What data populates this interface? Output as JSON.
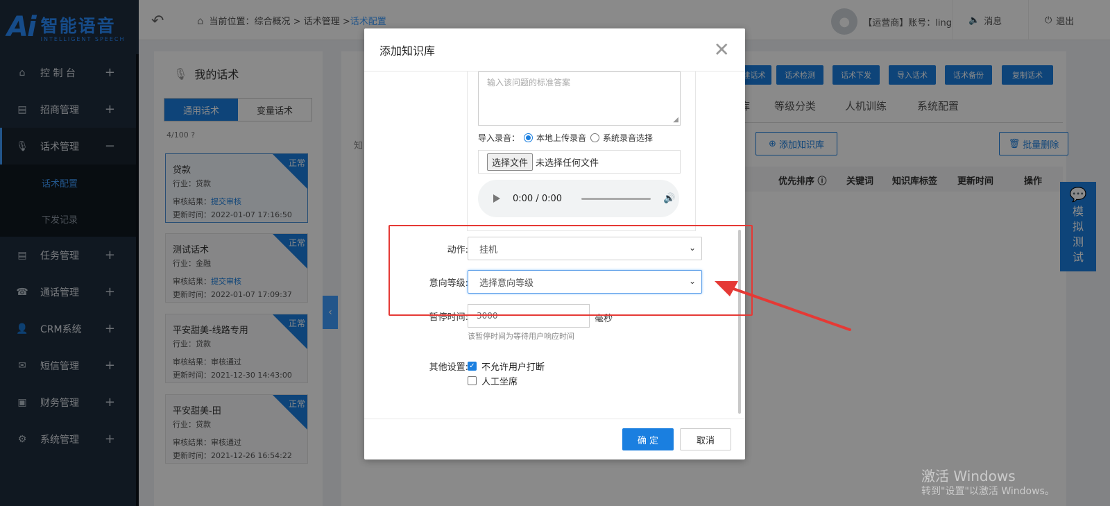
{
  "app": {
    "logo_mark": "Ai",
    "logo_title": "智能语音",
    "logo_sub": "INTELLIGENT SPEECH"
  },
  "sidebar": {
    "items": [
      {
        "label": "控 制 台",
        "icon": "home-icon",
        "toggle": "+"
      },
      {
        "label": "招商管理",
        "icon": "clipboard-icon",
        "toggle": "+"
      },
      {
        "label": "话术管理",
        "icon": "microphone-icon",
        "toggle": "−"
      },
      {
        "label": "任务管理",
        "icon": "clipboard-icon",
        "toggle": "+"
      },
      {
        "label": "通话管理",
        "icon": "phone-icon",
        "toggle": "+"
      },
      {
        "label": "CRM系统",
        "icon": "user-icon",
        "toggle": "+"
      },
      {
        "label": "短信管理",
        "icon": "mail-icon",
        "toggle": "+"
      },
      {
        "label": "财务管理",
        "icon": "wallet-icon",
        "toggle": "+"
      },
      {
        "label": "系统管理",
        "icon": "gear-icon",
        "toggle": "+"
      }
    ],
    "submenu": [
      {
        "label": "话术配置"
      },
      {
        "label": "下发记录"
      }
    ]
  },
  "header": {
    "breadcrumb_prefix": "当前位置：综合概况 > 话术管理 > ",
    "breadcrumb_current": "话术配置",
    "user_text": "【运营商】账号：ling",
    "messages": "消息",
    "logout": "退出"
  },
  "left_panel": {
    "title": "我的话术",
    "tabs": [
      "通用话术",
      "变量话术"
    ],
    "count": "4/100",
    "cards": [
      {
        "name": "贷款",
        "industry": "行业：贷款",
        "review_label": "审核结果：",
        "review_value": "提交审核",
        "updated": "更新时间：2022-01-07 17:16:50",
        "badge": "正常"
      },
      {
        "name": "测试话术",
        "industry": "行业：金融",
        "review_label": "审核结果：",
        "review_value": "提交审核",
        "updated": "更新时间：2022-01-07 17:09:37",
        "badge": "正常"
      },
      {
        "name": "平安甜美-线路专用",
        "industry": "行业：贷款",
        "review_label": "审核结果：",
        "review_value": "审核通过",
        "updated": "更新时间：2021-12-30 14:43:00",
        "badge": "正常"
      },
      {
        "name": "平安甜美-田",
        "industry": "行业：贷款",
        "review_label": "审核结果：",
        "review_value": "审核通过",
        "updated": "更新时间：2021-12-26 16:54:22",
        "badge": "正常"
      }
    ]
  },
  "right_panel": {
    "buttons": [
      "建话术",
      "话术检测",
      "话术下发",
      "导入话术",
      "话术备份",
      "复制话术"
    ],
    "tabs": [
      "库",
      "等级分类",
      "人机训练",
      "系统配置"
    ],
    "add_kb": "添加知识库",
    "batch_delete": "批量删除",
    "columns": [
      "优先排序",
      "关键词",
      "知识库标签",
      "更新时间",
      "操作"
    ],
    "faint": "知"
  },
  "float_test": {
    "chars": [
      "模",
      "拟",
      "测",
      "试"
    ]
  },
  "modal": {
    "title": "添加知识库",
    "answer_placeholder": "输入该问题的标准答案",
    "import_label": "导入录音：",
    "radio_local": "本地上传录音",
    "radio_system": "系统录音选择",
    "file_button": "选择文件",
    "file_status": "未选择任何文件",
    "audio_time": "0:00 / 0:00",
    "action_label": "动作:",
    "action_value": "挂机",
    "intent_label": "意向等级:",
    "intent_value": "选择意向等级",
    "pause_label": "暂停时间:",
    "pause_value": "3000",
    "pause_unit": "毫秒",
    "pause_hint": "该暂停时间为等待用户响应时间",
    "other_label": "其他设置:",
    "cb_no_interrupt": "不允许用户打断",
    "cb_no_interrupt_checked": true,
    "cb_agent": "人工坐席",
    "cb_agent_checked": false,
    "ok": "确 定",
    "cancel": "取消"
  },
  "watermark": {
    "line1": "激活 Windows",
    "line2": "转到\"设置\"以激活 Windows。"
  },
  "colors": {
    "accent": "#1a7fe0",
    "sidebar": "#1f2d3d",
    "annotation": "#e53935"
  }
}
